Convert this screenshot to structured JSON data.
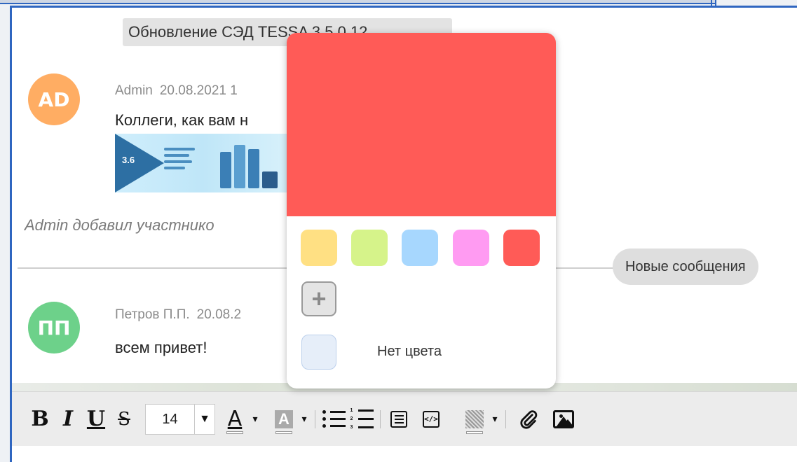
{
  "chat": {
    "topic_title": "Обновление СЭД TESSA 3.5.0.12",
    "new_messages_label": "Новые сообщения",
    "messages": [
      {
        "avatar_initials": "AD",
        "avatar_color": "#ffad63",
        "author": "Admin",
        "date": "20.08.2021 1",
        "text": "Коллеги, как вам н",
        "attachment_version": "3.6"
      },
      {
        "avatar_initials": "ПП",
        "avatar_color": "#6dd18a",
        "author": "Петров П.П.",
        "date": "20.08.2",
        "text": "всем привет!"
      }
    ],
    "system_message": "Admin добавил участнико"
  },
  "color_picker": {
    "selected_color": "#ff5b57",
    "swatches": [
      {
        "name": "yellow",
        "color": "#ffe083"
      },
      {
        "name": "green",
        "color": "#d6f38a"
      },
      {
        "name": "blue",
        "color": "#a7d7fe"
      },
      {
        "name": "pink",
        "color": "#ff9bf2"
      },
      {
        "name": "red",
        "color": "#ff5b57"
      }
    ],
    "add_label": "+",
    "no_color_label": "Нет цвета"
  },
  "toolbar": {
    "bold": "B",
    "italic": "I",
    "underline": "U",
    "strike": "S",
    "font_size": "14",
    "font_size_arrow": "▼",
    "text_color_glyph": "A",
    "highlight_glyph": "A",
    "caret": "▾",
    "code_glyph": "</>"
  },
  "icons": {
    "attach": "paperclip-icon",
    "image": "image-icon",
    "bullets": "bullet-list-icon",
    "numbers": "numbered-list-icon",
    "quote": "block-quote-icon",
    "code": "code-icon",
    "shading": "shading-icon"
  }
}
